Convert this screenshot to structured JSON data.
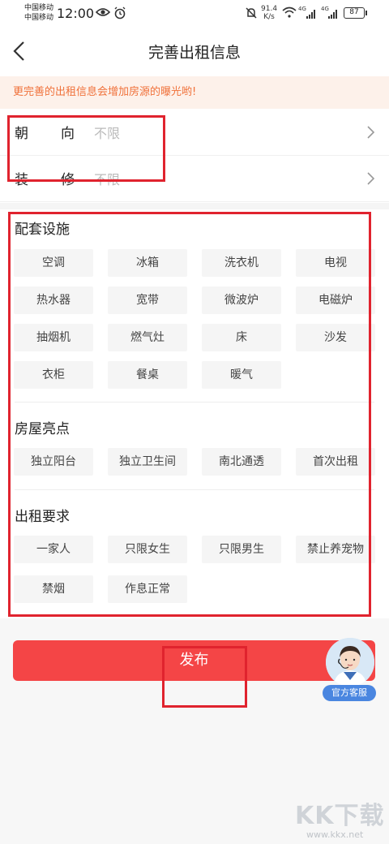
{
  "status_bar": {
    "carrier_1": "中国移动",
    "carrier_2": "中国移动",
    "time": "12:00",
    "net_speed_value": "91.4",
    "net_speed_unit": "K/s",
    "network_tag_1": "4G",
    "network_tag_2": "4G",
    "battery": "87"
  },
  "nav": {
    "title": "完善出租信息"
  },
  "notice": {
    "text": "更完善的出租信息会增加房源的曝光哟!"
  },
  "rows": [
    {
      "label": "朝向",
      "value": "不限"
    },
    {
      "label": "装修",
      "value": "不限"
    }
  ],
  "facilities": {
    "title": "配套设施",
    "items": [
      "空调",
      "冰箱",
      "洗衣机",
      "电视",
      "热水器",
      "宽带",
      "微波炉",
      "电磁炉",
      "抽烟机",
      "燃气灶",
      "床",
      "沙发",
      "衣柜",
      "餐桌",
      "暖气"
    ]
  },
  "highlights": {
    "title": "房屋亮点",
    "items": [
      "独立阳台",
      "独立卫生间",
      "南北通透",
      "首次出租"
    ]
  },
  "requirements": {
    "title": "出租要求",
    "items": [
      "一家人",
      "只限女生",
      "只限男生",
      "禁止养宠物",
      "禁烟",
      "作息正常"
    ]
  },
  "publish": {
    "label": "发布"
  },
  "service": {
    "label": "官方客服"
  },
  "watermark": {
    "brand": "KK下载",
    "url": "www.kkx.net"
  },
  "colors": {
    "accent": "#f44546",
    "notice_text": "#f0713a",
    "notice_bg": "#fdf1ea",
    "annotation": "#e0232e",
    "service_badge": "#4a86e0"
  }
}
